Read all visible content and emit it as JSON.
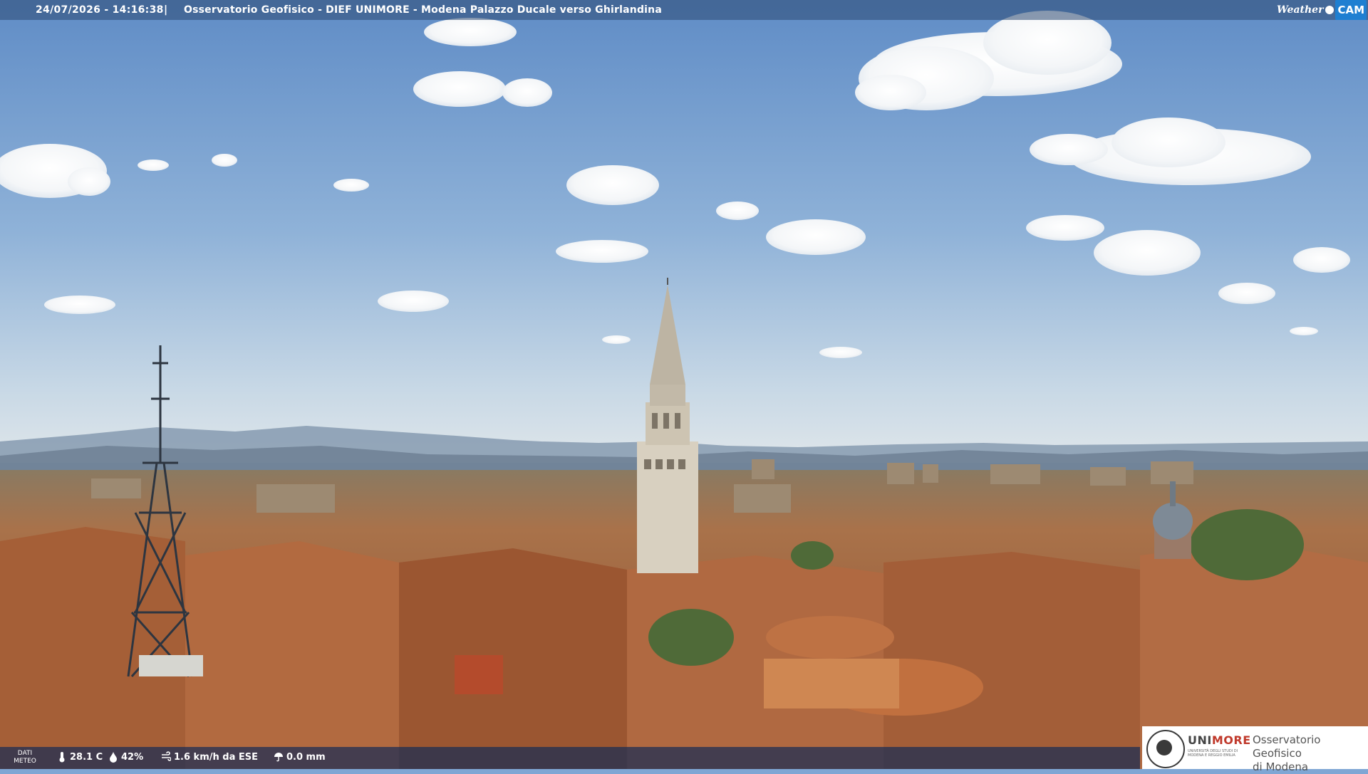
{
  "overlay": {
    "timestamp": "24/07/2026 - 14:16:38",
    "separator": "|",
    "caption": "Osservatorio Geofisico - DIEF UNIMORE - Modena Palazzo Ducale verso Ghirlandina",
    "brand_weather": "Weather",
    "brand_cam": "CAM"
  },
  "weather": {
    "label_line1": "DATI",
    "label_line2": "METEO",
    "temperature": "28.1 C",
    "humidity": "42%",
    "wind": "1.6 km/h da ESE",
    "rain": "0.0 mm"
  },
  "logo": {
    "uni": "UNI",
    "more": "MORE",
    "uni_sub": "UNIVERSITÀ DEGLI STUDI DI MODENA E REGGIO EMILIA",
    "observatory_line1": "Osservatorio Geofisico",
    "observatory_line2": "di Modena"
  },
  "colors": {
    "sky_top": "#5f8cc6",
    "sky_horizon": "#c9d9e6",
    "roof_terracotta": "#b5683f",
    "tower_stone": "#d8d0c0",
    "accent_red": "#c0392b",
    "bar_blue": "#1f7fd1"
  }
}
